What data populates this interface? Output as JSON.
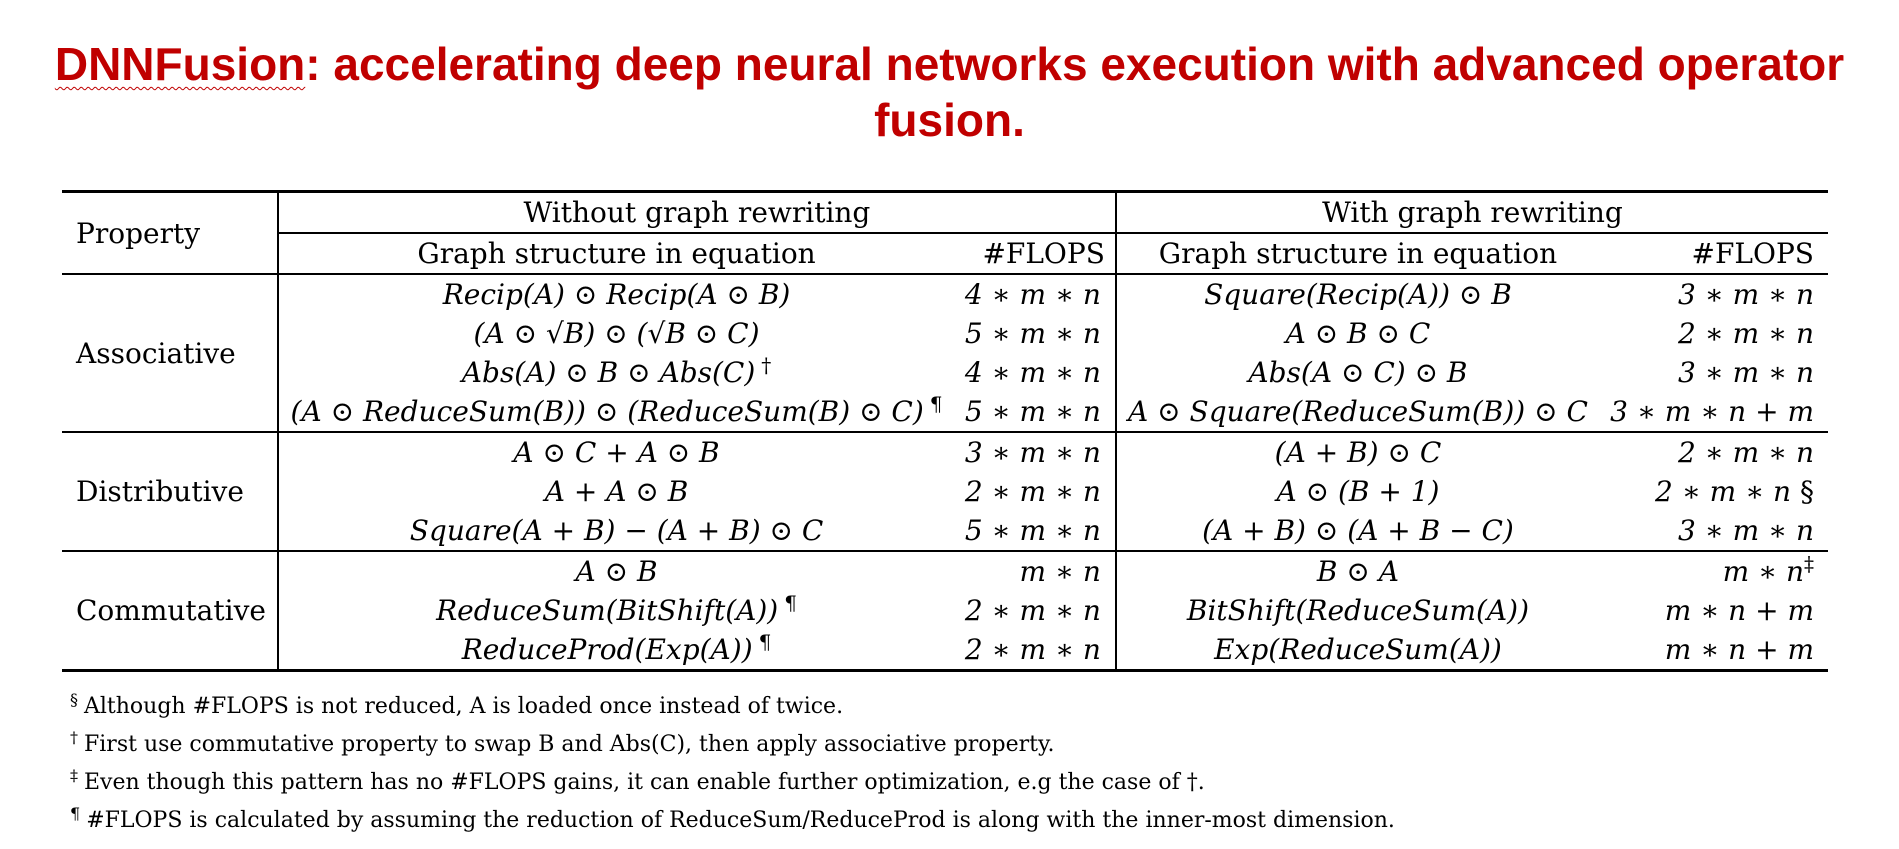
{
  "title": {
    "part1": "DNNFusion",
    "part2": ": accelerating deep neural networks execution with advanced operator fusion."
  },
  "table": {
    "property_header": "Property",
    "without_header": "Without graph rewriting",
    "with_header": "With graph rewriting",
    "eq_col_header": "Graph structure in equation",
    "flops_col_header": "#FLOPS",
    "groups": [
      {
        "property": "Associative",
        "rows": [
          {
            "without_eq": "Recip(A) ⊙ Recip(A ⊙ B)",
            "without_mark": "",
            "without_flops": "4 ∗ m ∗ n",
            "with_eq": "Square(Recip(A)) ⊙ B",
            "with_flops": "3 ∗ m ∗ n",
            "with_mark": ""
          },
          {
            "without_eq": "(A ⊙ √B) ⊙ (√B ⊙ C)",
            "without_mark": "",
            "without_flops": "5 ∗ m ∗ n",
            "with_eq": "A ⊙ B ⊙ C",
            "with_flops": "2 ∗ m ∗ n",
            "with_mark": ""
          },
          {
            "without_eq": "Abs(A) ⊙ B ⊙ Abs(C)",
            "without_mark": "†",
            "without_flops": "4 ∗ m ∗ n",
            "with_eq": "Abs(A ⊙ C) ⊙ B",
            "with_flops": "3 ∗ m ∗ n",
            "with_mark": ""
          },
          {
            "without_eq": "(A ⊙ ReduceSum(B)) ⊙ (ReduceSum(B) ⊙ C)",
            "without_mark": "¶",
            "without_flops": "5 ∗ m ∗ n",
            "with_eq": "A ⊙ Square(ReduceSum(B)) ⊙ C",
            "with_flops": "3 ∗ m ∗ n + m",
            "with_mark": ""
          }
        ]
      },
      {
        "property": "Distributive",
        "rows": [
          {
            "without_eq": "A ⊙ C + A ⊙ B",
            "without_mark": "",
            "without_flops": "3 ∗ m ∗ n",
            "with_eq": "(A + B) ⊙ C",
            "with_flops": "2 ∗ m ∗ n",
            "with_mark": ""
          },
          {
            "without_eq": "A + A ⊙ B",
            "without_mark": "",
            "without_flops": "2 ∗ m ∗ n",
            "with_eq": "A ⊙ (B + 1)",
            "with_flops": "2 ∗ m ∗ n",
            "with_mark": " §"
          },
          {
            "without_eq": "Square(A + B) − (A + B) ⊙ C",
            "without_mark": "",
            "without_flops": "5 ∗ m ∗ n",
            "with_eq": "(A + B) ⊙ (A + B − C)",
            "with_flops": "3 ∗ m ∗ n",
            "with_mark": ""
          }
        ]
      },
      {
        "property": "Commutative",
        "rows": [
          {
            "without_eq": "A ⊙ B",
            "without_mark": "",
            "without_flops": "m ∗ n",
            "with_eq": "B ⊙ A",
            "with_flops": "m ∗ n",
            "with_mark": "‡"
          },
          {
            "without_eq": "ReduceSum(BitShift(A))",
            "without_mark": "¶",
            "without_flops": "2 ∗ m ∗ n",
            "with_eq": "BitShift(ReduceSum(A))",
            "with_flops": "m ∗ n + m",
            "with_mark": ""
          },
          {
            "without_eq": "ReduceProd(Exp(A))",
            "without_mark": "¶",
            "without_flops": "2 ∗ m ∗ n",
            "with_eq": "Exp(ReduceSum(A))",
            "with_flops": "m ∗ n + m",
            "with_mark": ""
          }
        ]
      }
    ]
  },
  "footnotes": [
    {
      "mark": "§",
      "text": "Although #FLOPS is not reduced, A is loaded once instead of twice."
    },
    {
      "mark": "†",
      "text": "First use commutative property to swap B and Abs(C), then apply associative property."
    },
    {
      "mark": "‡",
      "text": "Even though this pattern has no #FLOPS gains, it can enable further optimization, e.g the case of †."
    },
    {
      "mark": "¶",
      "text": "#FLOPS is calculated by assuming the reduction of ReduceSum/ReduceProd is along with the inner-most dimension."
    }
  ]
}
